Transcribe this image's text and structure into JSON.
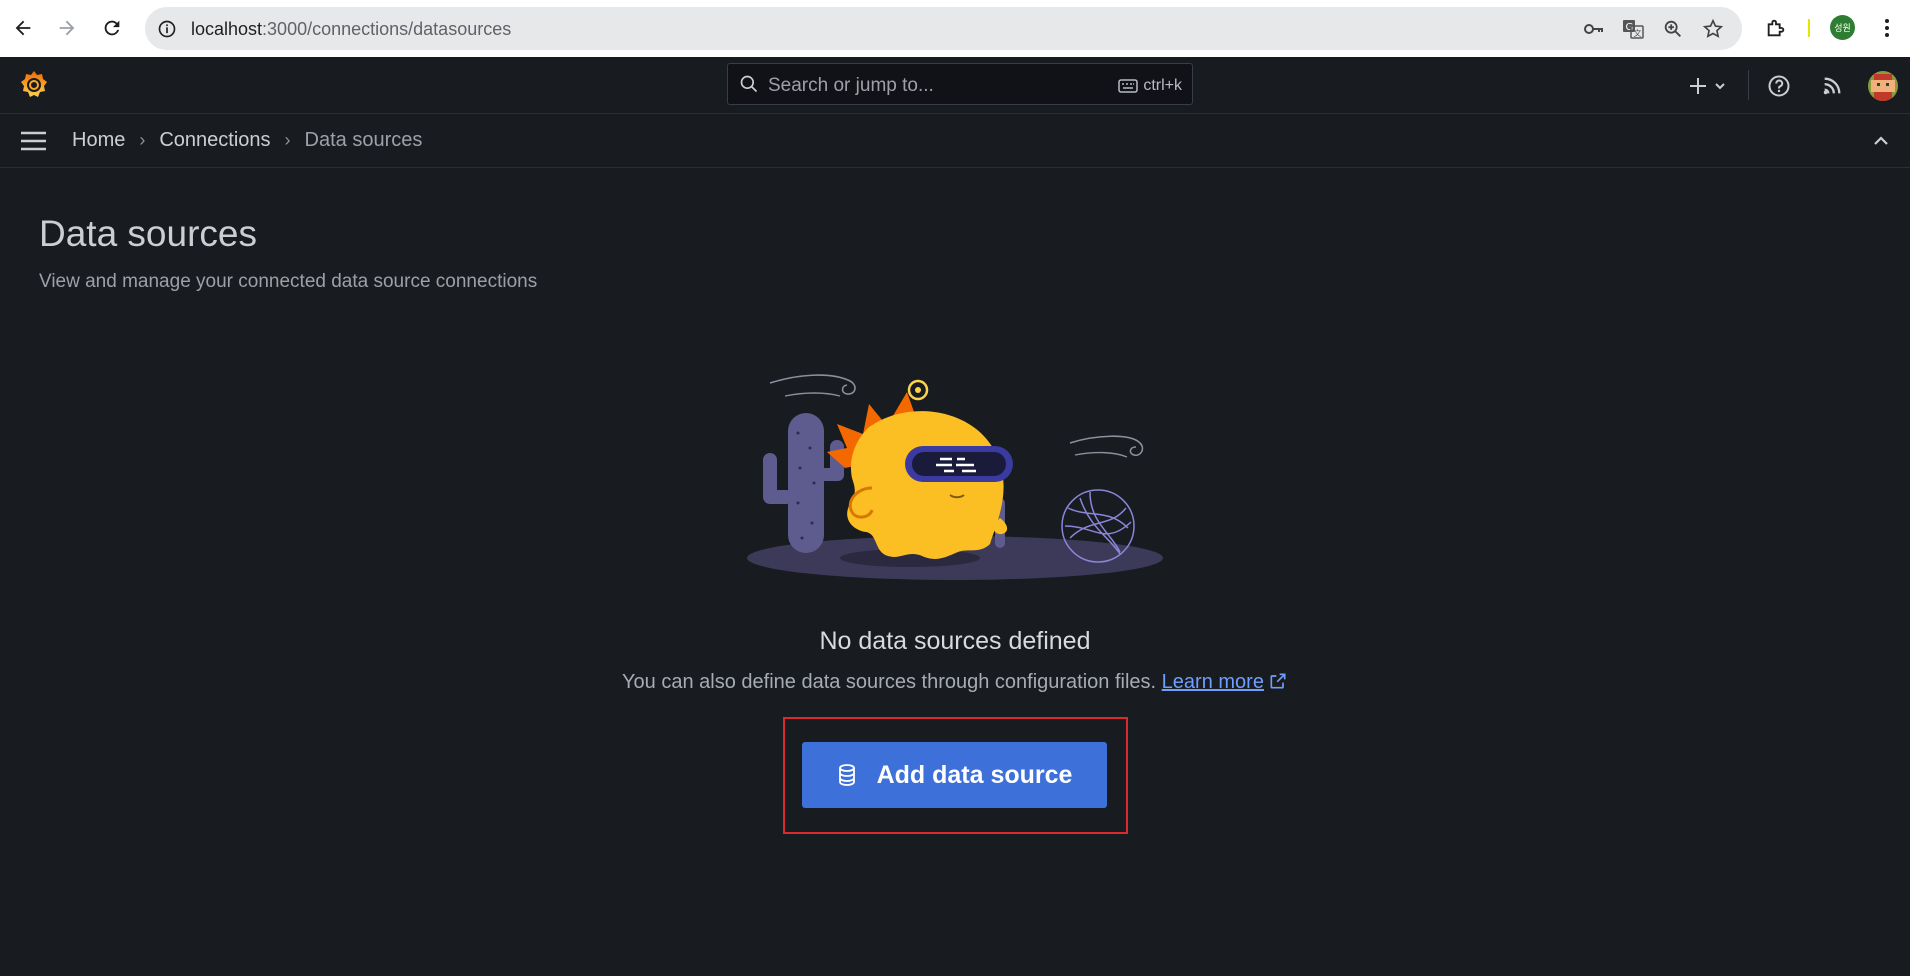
{
  "browser": {
    "url_host": "localhost",
    "url_path": ":3000/connections/datasources",
    "profile_label": "성원"
  },
  "header": {
    "search_placeholder": "Search or jump to...",
    "shortcut": "ctrl+k"
  },
  "breadcrumb": {
    "items": [
      "Home",
      "Connections",
      "Data sources"
    ],
    "separator": "›"
  },
  "page": {
    "title": "Data sources",
    "subtitle": "View and manage your connected data source connections"
  },
  "empty_state": {
    "title": "No data sources defined",
    "description": "You can also define data sources through configuration files.",
    "learn_more": "Learn more"
  },
  "actions": {
    "add_label": "Add data source"
  },
  "colors": {
    "background": "#181b1f",
    "primary": "#3d71d9",
    "link": "#6e9fff",
    "highlight": "#d92b2b",
    "brand_orange": "#f46800"
  }
}
